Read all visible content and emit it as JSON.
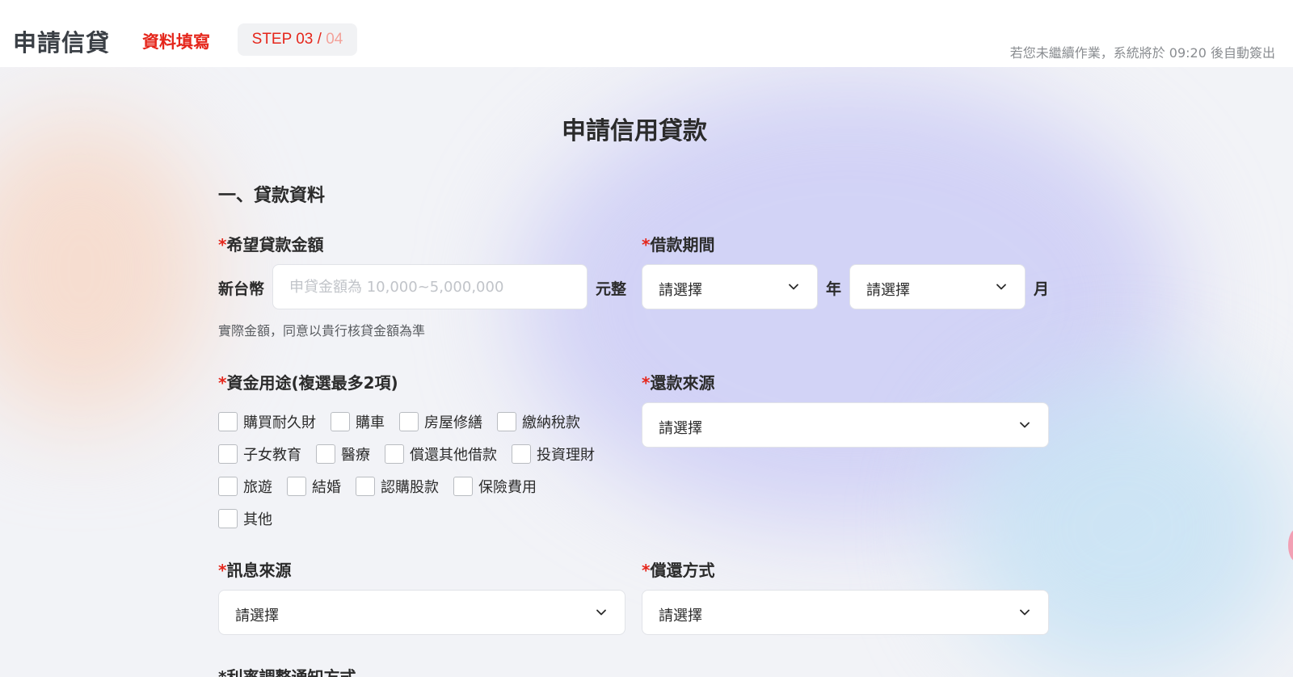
{
  "header": {
    "brand": "申請信貸",
    "step_title": "資料填寫",
    "step_current": "STEP 03",
    "step_sep": " / ",
    "step_total": "04",
    "timeout_text": "若您未繼續作業，系統將於 09:20 後自動簽出"
  },
  "page": {
    "heading": "申請信用貸款",
    "section_title": "一、貸款資料"
  },
  "form": {
    "required_mark": "*",
    "amount": {
      "label": "希望貸款金額",
      "prefix": "新台幣",
      "placeholder": "申貸金額為 10,000~5,000,000",
      "suffix": "元整",
      "note": "實際金額，同意以貴行核貸金額為準"
    },
    "period": {
      "label": "借款期間",
      "year_value": "請選擇",
      "year_unit": "年",
      "month_value": "請選擇",
      "month_unit": "月"
    },
    "purpose": {
      "label": "資金用途(複選最多2項)",
      "rows": [
        [
          "購買耐久財",
          "購車",
          "房屋修繕",
          "繳納稅款"
        ],
        [
          "子女教育",
          "醫療",
          "償還其他借款",
          "投資理財"
        ],
        [
          "旅遊",
          "結婚",
          "認購股款",
          "保險費用"
        ],
        [
          "其他"
        ]
      ]
    },
    "repay_source": {
      "label": "還款來源",
      "value": "請選擇"
    },
    "info_source": {
      "label": "訊息來源",
      "value": "請選擇"
    },
    "repay_method": {
      "label": "償還方式",
      "value": "請選擇"
    },
    "next_label": "利率調整通知方式"
  },
  "icons": {
    "chevron": "chevron-down-icon"
  },
  "colors": {
    "accent": "#e5261b",
    "accent_light": "#f3a29a",
    "text": "#2b2b2b"
  }
}
